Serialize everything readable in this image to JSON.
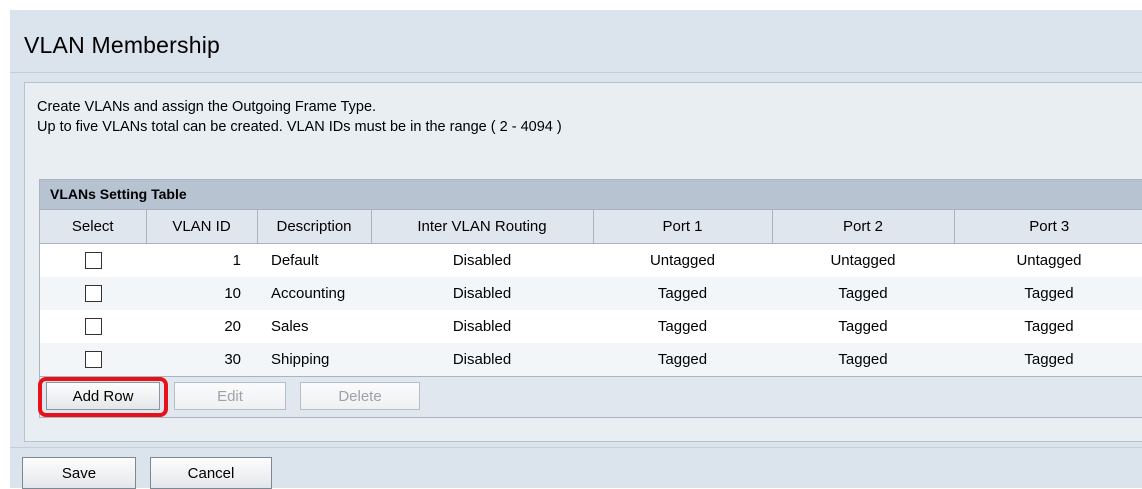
{
  "page": {
    "title": "VLAN Membership",
    "description_line1": "Create VLANs and assign the Outgoing Frame Type.",
    "description_line2": "Up to five VLANs total can be created. VLAN IDs must be in the range ( 2 - 4094 )"
  },
  "table": {
    "title": "VLANs Setting Table",
    "columns": [
      "Select",
      "VLAN ID",
      "Description",
      "Inter VLAN Routing",
      "Port 1",
      "Port 2",
      "Port 3"
    ],
    "rows": [
      {
        "vlan_id": "1",
        "description": "Default",
        "routing": "Disabled",
        "port1": "Untagged",
        "port2": "Untagged",
        "port3": "Untagged",
        "selected": false
      },
      {
        "vlan_id": "10",
        "description": "Accounting",
        "routing": "Disabled",
        "port1": "Tagged",
        "port2": "Tagged",
        "port3": "Tagged",
        "selected": false
      },
      {
        "vlan_id": "20",
        "description": "Sales",
        "routing": "Disabled",
        "port1": "Tagged",
        "port2": "Tagged",
        "port3": "Tagged",
        "selected": false
      },
      {
        "vlan_id": "30",
        "description": "Shipping",
        "routing": "Disabled",
        "port1": "Tagged",
        "port2": "Tagged",
        "port3": "Tagged",
        "selected": false
      }
    ],
    "buttons": {
      "add_row": "Add Row",
      "edit": "Edit",
      "delete": "Delete"
    }
  },
  "footer": {
    "save": "Save",
    "cancel": "Cancel"
  },
  "colors": {
    "highlight": "#e8101a",
    "header_bar": "#b7c3d0",
    "page_background": "#dbe3ec"
  }
}
